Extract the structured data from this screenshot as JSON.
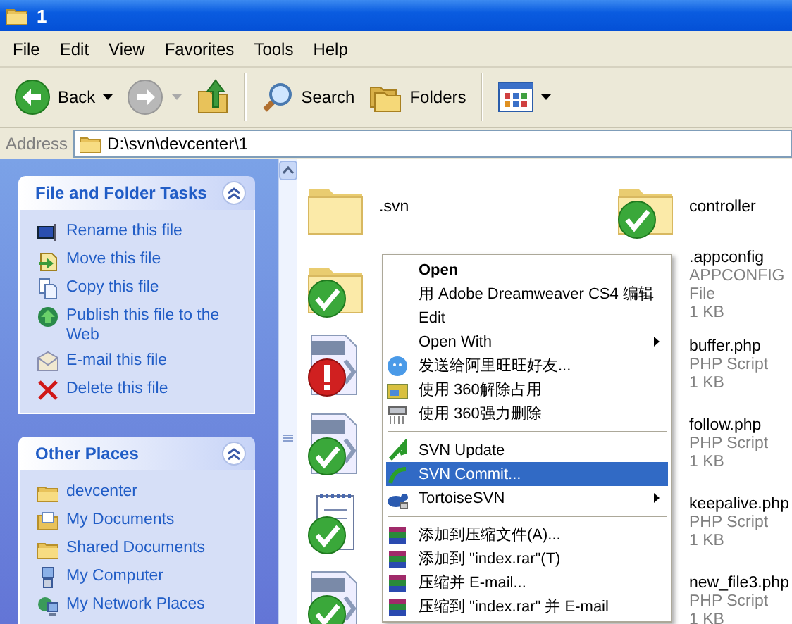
{
  "window": {
    "title": "1"
  },
  "menu_bar": [
    "File",
    "Edit",
    "View",
    "Favorites",
    "Tools",
    "Help"
  ],
  "toolbar": [
    {
      "kind": "back",
      "label": "Back",
      "disabled": false
    },
    {
      "kind": "forward",
      "disabled": true
    },
    {
      "kind": "up"
    },
    {
      "kind": "separator"
    },
    {
      "kind": "search",
      "label": "Search"
    },
    {
      "kind": "folders",
      "label": "Folders"
    },
    {
      "kind": "separator"
    },
    {
      "kind": "views"
    }
  ],
  "address": {
    "label": "Address",
    "value": "D:\\svn\\devcenter\\1"
  },
  "task_panels": [
    {
      "title": "File and Folder Tasks",
      "expanded": true,
      "items": [
        "Rename this file",
        "Move this file",
        "Copy this file",
        "Publish this file to the Web",
        "E-mail this file",
        "Delete this file"
      ]
    },
    {
      "title": "Other Places",
      "expanded": true,
      "items": [
        "devcenter",
        "My Documents",
        "Shared Documents",
        "My Computer",
        "My Network Places"
      ]
    }
  ],
  "files": [
    {
      "kind": "folder",
      "lines": [
        ".svn"
      ]
    },
    {
      "kind": "folder-ok",
      "lines": [
        "controller"
      ]
    },
    {
      "kind": "folder-ok"
    },
    {
      "lines": [
        ".appconfig",
        "APPCONFIG File",
        "1 KB"
      ]
    },
    {
      "kind": "php-conflict"
    },
    {
      "lines": [
        "buffer.php",
        "PHP Script",
        "1 KB"
      ]
    },
    {
      "kind": "php-ok"
    },
    {
      "lines": [
        "follow.php",
        "PHP Script",
        "1 KB"
      ]
    },
    {
      "kind": "notepad-ok"
    },
    {
      "lines": [
        "keepalive.php",
        "PHP Script",
        "1 KB"
      ]
    },
    {
      "kind": "php-ok"
    },
    {
      "lines": [
        "new_file3.php",
        "PHP Script",
        "1 KB"
      ]
    }
  ],
  "context_menu": [
    {
      "kind": "item",
      "label": "Open",
      "bold": true,
      "submenu": false,
      "selected": false
    },
    {
      "kind": "item",
      "label": "用 Adobe Dreamweaver CS4 编辑",
      "bold": false,
      "submenu": false,
      "selected": false
    },
    {
      "kind": "item",
      "label": "Edit",
      "bold": false,
      "submenu": false,
      "selected": false
    },
    {
      "kind": "item",
      "label": "Open With",
      "bold": false,
      "submenu": true,
      "selected": false
    },
    {
      "kind": "item",
      "label": "发送给阿里旺旺好友...",
      "bold": false,
      "submenu": false,
      "selected": false
    },
    {
      "kind": "item",
      "label": "使用 360解除占用",
      "bold": false,
      "submenu": false,
      "selected": false
    },
    {
      "kind": "item",
      "label": "使用 360强力删除",
      "bold": false,
      "submenu": false,
      "selected": false
    },
    {
      "kind": "separator"
    },
    {
      "kind": "item",
      "label": "SVN Update",
      "bold": false,
      "submenu": false,
      "selected": false
    },
    {
      "kind": "item",
      "label": "SVN Commit...",
      "bold": false,
      "submenu": false,
      "selected": true
    },
    {
      "kind": "item",
      "label": "TortoiseSVN",
      "bold": false,
      "submenu": true,
      "selected": false
    },
    {
      "kind": "separator"
    },
    {
      "kind": "item",
      "label": "添加到压缩文件(A)...",
      "bold": false,
      "submenu": false,
      "selected": false
    },
    {
      "kind": "item",
      "label": "添加到 \"index.rar\"(T)",
      "bold": false,
      "submenu": false,
      "selected": false
    },
    {
      "kind": "item",
      "label": "压缩并 E-mail...",
      "bold": false,
      "submenu": false,
      "selected": false
    },
    {
      "kind": "item",
      "label": "压缩到 \"index.rar\" 并 E-mail",
      "bold": false,
      "submenu": false,
      "selected": false
    }
  ]
}
